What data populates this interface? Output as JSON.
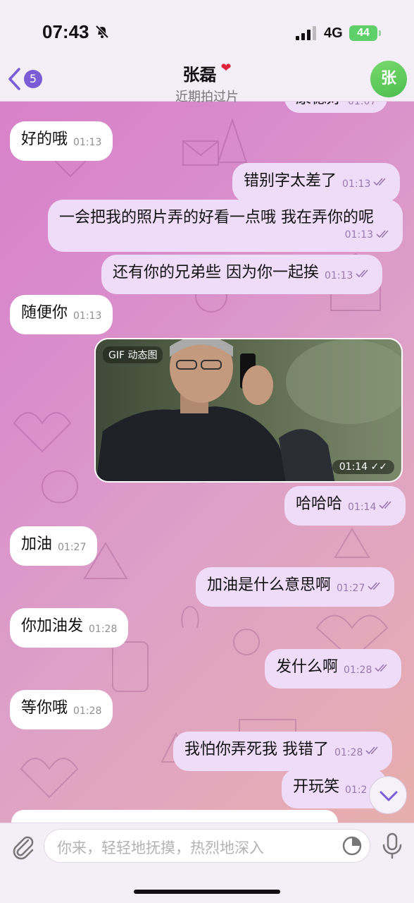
{
  "status": {
    "time": "07:43",
    "network": "4G",
    "battery": "44"
  },
  "header": {
    "back_count": "5",
    "title": "张磊",
    "subtitle": "近期拍过片",
    "avatar": "张"
  },
  "messages": [
    {
      "dir": "out",
      "text": "康德好",
      "time": "01:07"
    },
    {
      "dir": "in",
      "text": "好的哦",
      "time": "01:13"
    },
    {
      "dir": "out",
      "text": "错别字太差了",
      "time": "01:13"
    },
    {
      "dir": "out",
      "text": "一会把我的照片弄的好看一点哦 我在弄你的呢",
      "time": "01:13"
    },
    {
      "dir": "out",
      "text": "还有你的兄弟些 因为你一起挨",
      "time": "01:13"
    },
    {
      "dir": "in",
      "text": "随便你",
      "time": "01:13"
    },
    {
      "dir": "out",
      "gif_label": "GIF 动态图",
      "time": "01:14"
    },
    {
      "dir": "out",
      "text": "哈哈哈",
      "time": "01:14"
    },
    {
      "dir": "in",
      "text": "加油",
      "time": "01:27"
    },
    {
      "dir": "out",
      "text": "加油是什么意思啊",
      "time": "01:27"
    },
    {
      "dir": "in",
      "text": "你加油发",
      "time": "01:28"
    },
    {
      "dir": "out",
      "text": "发什么啊",
      "time": "01:28"
    },
    {
      "dir": "in",
      "text": "等你哦",
      "time": "01:28"
    },
    {
      "dir": "out",
      "text": "我怕你弄死我 我错了",
      "time": "01:28"
    },
    {
      "dir": "out",
      "text": "开玩笑",
      "time": "01:2"
    }
  ],
  "input": {
    "placeholder": "你来，轻轻地抚摸，热烈地深入"
  },
  "icons": [
    "bell-slash-icon",
    "signal-icon",
    "back-chevron-icon",
    "heart-icon",
    "double-check-icon",
    "chevron-down-icon",
    "paperclip-icon",
    "sticker-icon",
    "microphone-icon"
  ],
  "colors": {
    "accent": "#7b5bd6",
    "avatar": "#5cc85a",
    "outgoing": "#efdcf8",
    "incoming": "#ffffff"
  }
}
